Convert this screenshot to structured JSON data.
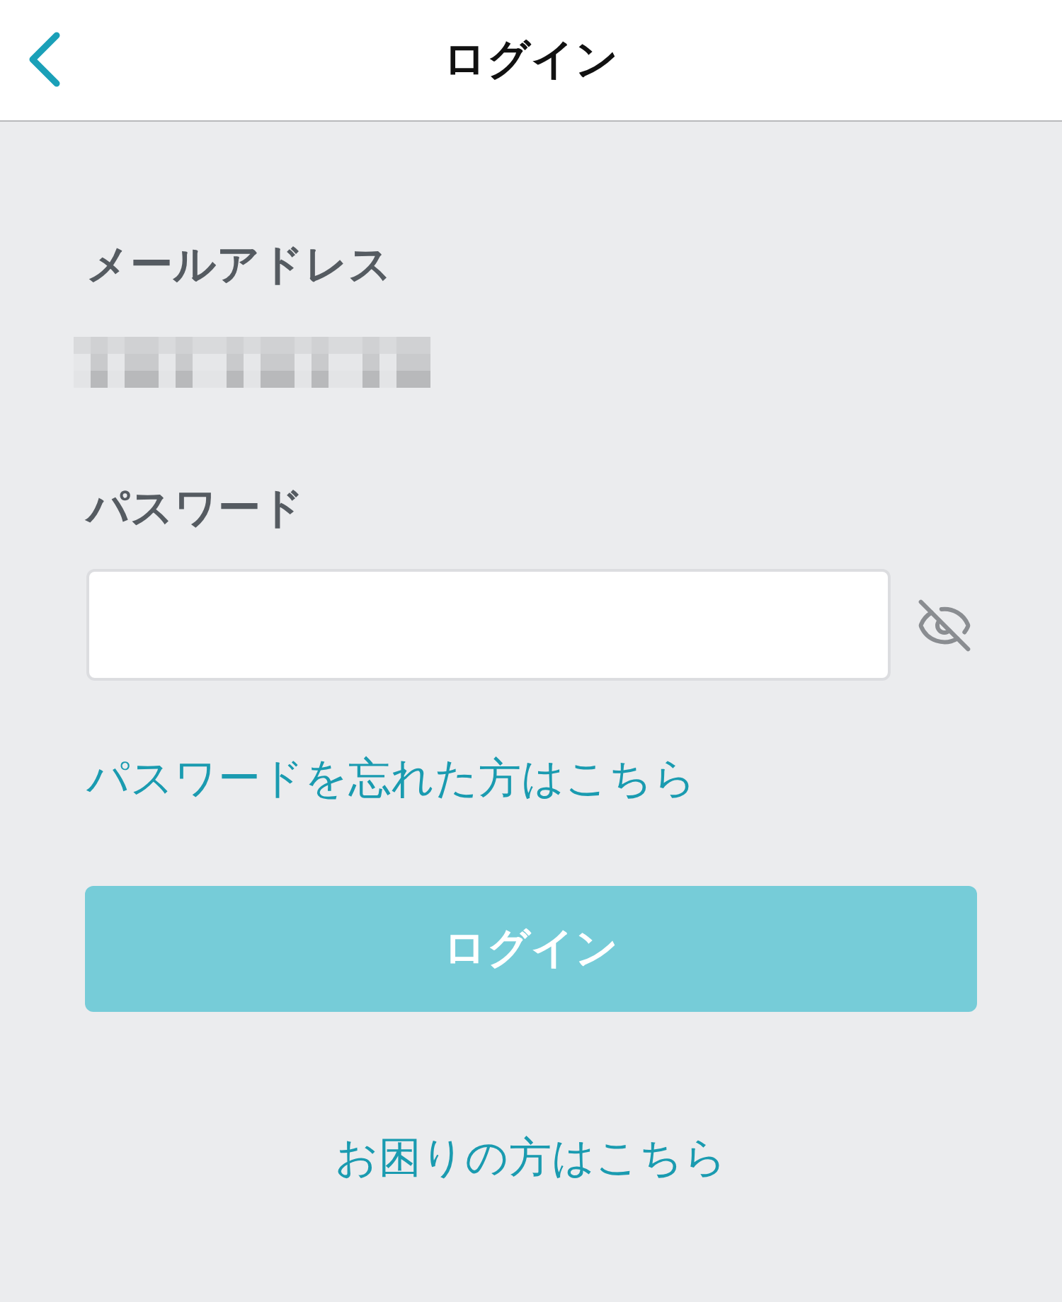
{
  "header": {
    "title": "ログイン"
  },
  "email": {
    "label": "メールアドレス"
  },
  "password": {
    "label": "パスワード",
    "visible": false
  },
  "forgot_link": "パスワードを忘れた方はこちら",
  "login_button": {
    "label": "ログイン",
    "disabled": true
  },
  "help_link": "お困りの方はこちら"
}
